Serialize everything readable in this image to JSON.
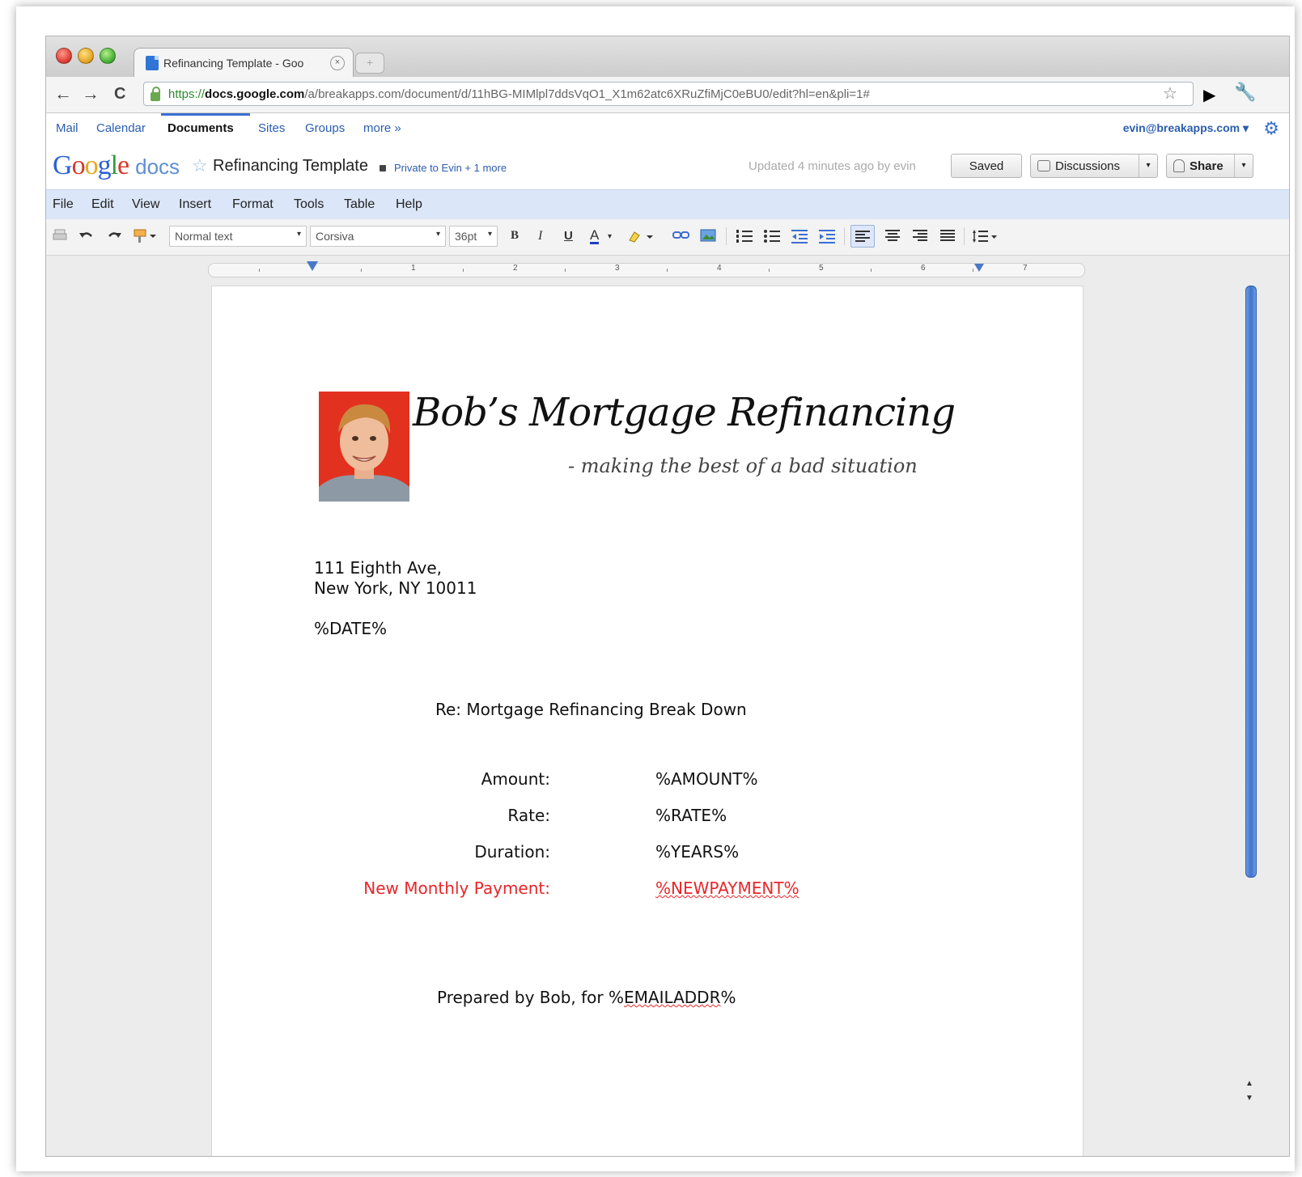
{
  "browser": {
    "tab_title": "Refinancing Template - Goo",
    "tab_close": "×",
    "new_tab": "+",
    "url_scheme": "https://",
    "url_host": "docs.google.com",
    "url_path": "/a/breakapps.com/document/d/11hBG-MIMlpl7ddsVqO1_X1m62atc6XRuZfiMjC0eBU0/edit?hl=en&pli=1#",
    "back": "←",
    "forward": "→",
    "reload": "C",
    "star": "☆",
    "wrench": "🔧",
    "extension": "▶"
  },
  "gbar": {
    "links": [
      "Mail",
      "Calendar",
      "Documents",
      "Sites",
      "Groups",
      "more »"
    ],
    "account": "evin@breakapps.com ▾",
    "gear": "⚙"
  },
  "docs_header": {
    "logo_parts": [
      "G",
      "o",
      "o",
      "g",
      "l",
      "e"
    ],
    "logo_product": "docs",
    "fav_star": "☆",
    "title": "Refinancing Template",
    "privacy": "Private to Evin + 1 more",
    "updated": "Updated 4 minutes ago by evin",
    "saved_button": "Saved",
    "discussions_button": "Discussions",
    "share_button": "Share",
    "caret": "▾"
  },
  "menu": [
    "File",
    "Edit",
    "View",
    "Insert",
    "Format",
    "Tools",
    "Table",
    "Help"
  ],
  "toolbar": {
    "style_value": "Normal text",
    "font_value": "Corsiva",
    "size_value": "36pt",
    "bold": "B",
    "italic": "I",
    "underline": "U",
    "text_color": "A",
    "dropdown": "▾"
  },
  "ruler": {
    "numbers": [
      "1",
      "2",
      "3",
      "4",
      "5",
      "6",
      "7"
    ]
  },
  "document": {
    "heading": "Bob’s Mortgage Refinancing",
    "tagline": "- making the best of a bad situation",
    "address_line1": "111 Eighth Ave,",
    "address_line2": "New York, NY 10011",
    "date_placeholder": "%DATE%",
    "re_line": "Re: Mortgage Refinancing Break Down",
    "rows": [
      {
        "label": "Amount:",
        "value": "%AMOUNT%"
      },
      {
        "label": "Rate:",
        "value": "%RATE%"
      },
      {
        "label": "Duration:",
        "value": "%YEARS%"
      },
      {
        "label": "New Monthly Payment:",
        "value": "%NEWPAYMENT%"
      }
    ],
    "prepared_prefix": "Prepared by Bob, for %",
    "prepared_var": "EMAILADDR",
    "prepared_suffix": "%"
  },
  "colors": {
    "accent": "#2a5db0",
    "menubar": "#dbe6f8",
    "highlight_red": "#e8262a"
  }
}
